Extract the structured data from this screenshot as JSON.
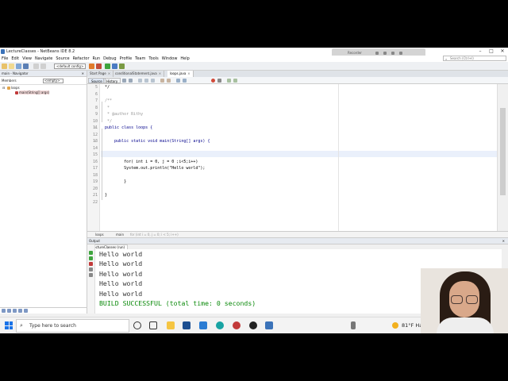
{
  "window": {
    "title": "LectureClasses - NetBeans IDE 8.2"
  },
  "recorder": {
    "label": "Recorder"
  },
  "menu": [
    "File",
    "Edit",
    "View",
    "Navigate",
    "Source",
    "Refactor",
    "Run",
    "Debug",
    "Profile",
    "Team",
    "Tools",
    "Window",
    "Help"
  ],
  "search": {
    "placeholder": "Search (Ctrl+I)"
  },
  "toolbar": {
    "config": "<default config>"
  },
  "navigator": {
    "header": "main - Navigator",
    "members_label": "Members",
    "filter_value": "<empty>",
    "tree": {
      "root": "loops",
      "child": "main(String[] args)"
    }
  },
  "tabs": [
    {
      "label": "Start Page",
      "active": false
    },
    {
      "label": "conditionalStatement.java",
      "active": false
    },
    {
      "label": "loops.java",
      "active": true
    }
  ],
  "editor_toolbar": {
    "source": "Source",
    "history": "History"
  },
  "code": {
    "lines": [
      {
        "n": "5",
        "text": "*/"
      },
      {
        "n": "6",
        "text": ""
      },
      {
        "n": "7",
        "text": "/**"
      },
      {
        "n": "8",
        "text": " *"
      },
      {
        "n": "9",
        "text": " * @author Rithy"
      },
      {
        "n": "10",
        "text": " */"
      },
      {
        "n": "11",
        "text": "public class loops {"
      },
      {
        "n": "12",
        "text": ""
      },
      {
        "n": "13",
        "text": "    public static void main(String[] args) {"
      },
      {
        "n": "14",
        "text": ""
      },
      {
        "n": "15",
        "text": ""
      },
      {
        "n": "16",
        "text": "        for( int i = 0, j = 0 ;i<5;i++)"
      },
      {
        "n": "17",
        "text": "        System.out.println(\"Hello world\");"
      },
      {
        "n": "18",
        "text": ""
      },
      {
        "n": "19",
        "text": "        }"
      },
      {
        "n": "20",
        "text": ""
      },
      {
        "n": "21",
        "text": "}"
      },
      {
        "n": "22",
        "text": ""
      }
    ]
  },
  "breadcrumbs": [
    "loops",
    "main",
    "for (int i = 0, j = 0; i < 5; i++)"
  ],
  "output": {
    "header": "Output",
    "tab": "LectureClasses (run)",
    "lines": [
      "Hello world",
      "Hello world",
      "Hello world",
      "Hello world",
      "Hello world"
    ],
    "status": "BUILD SUCCESSFUL (total time: 0 seconds)"
  },
  "taskbar": {
    "search_placeholder": "Type here to search",
    "weather": "81°F Ha"
  },
  "colors": {
    "keyword": "#00008b",
    "string": "#b35a00",
    "comment": "#999999",
    "build_success": "#0b8a0b",
    "accent": "#1a73e8"
  }
}
